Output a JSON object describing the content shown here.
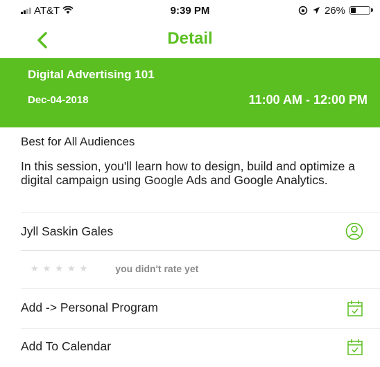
{
  "status_bar": {
    "carrier": "AT&T",
    "time": "9:39 PM",
    "battery": "26%",
    "battery_level": 0.26
  },
  "nav": {
    "title": "Detail",
    "back_icon": "chevron-left-icon"
  },
  "event": {
    "title": "Digital Advertising 101",
    "date": "Dec-04-2018",
    "time": "11:00 AM - 12:00 PM"
  },
  "audience": "Best for All Audiences",
  "description": "In this session, you'll learn how to design, build and optimize a digital campaign using Google Ads and Google Analytics.",
  "speaker": {
    "name": "Jyll Saskin Gales",
    "icon": "user-icon"
  },
  "rating": {
    "stars": 5,
    "text": "you didn't rate yet"
  },
  "actions": [
    {
      "label": "Add -> Personal Program",
      "icon": "calendar-check-icon"
    },
    {
      "label": "Add To Calendar",
      "icon": "calendar-check-icon"
    }
  ],
  "colors": {
    "accent": "#5bbf21",
    "header_text": "#ffffff",
    "star_empty": "#dadada"
  }
}
